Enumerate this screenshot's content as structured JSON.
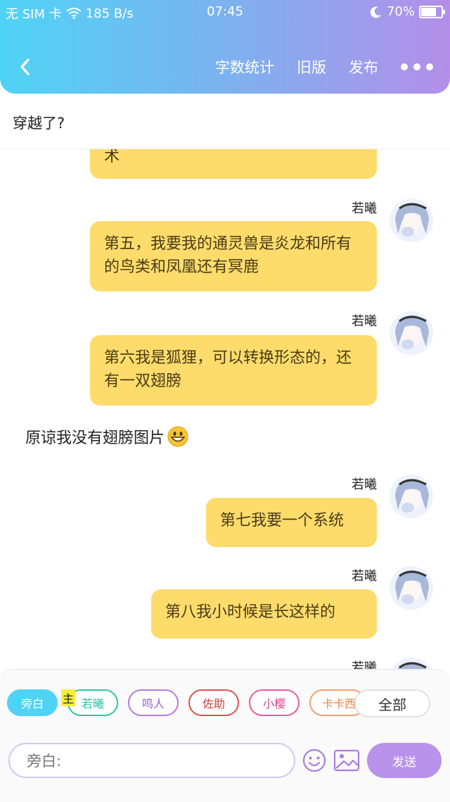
{
  "status_bar": {
    "carrier": "无 SIM 卡",
    "speed": "185 B/s",
    "time": "07:45",
    "battery": "70%",
    "battery_level": 0.7
  },
  "nav": {
    "word_count": "字数统计",
    "old_version": "旧版",
    "publish": "发布"
  },
  "story_title": "穿越了?",
  "messages": {
    "partial": {
      "text": "术"
    },
    "m5": {
      "speaker": "若曦",
      "text": "第五，我要我的通灵兽是炎龙和所有的鸟类和凤凰还有冥鹿"
    },
    "m6": {
      "speaker": "若曦",
      "text": "第六我是狐狸，可以转换形态的，还有一双翅膀"
    },
    "narration": {
      "text": "原谅我没有翅膀图片"
    },
    "m7": {
      "speaker": "若曦",
      "text": "第七我要一个系统"
    },
    "m8": {
      "speaker": "若曦",
      "text": "第八我小时候是长这样的"
    },
    "m9": {
      "speaker": "若曦"
    }
  },
  "characters": [
    {
      "label": "旁白",
      "color": "#4fd3f5",
      "active": true
    },
    {
      "label": "若曦",
      "color": "#2ec4a8"
    },
    {
      "label": "鸣人",
      "color": "#b27cdc"
    },
    {
      "label": "佐助",
      "color": "#e0504e"
    },
    {
      "label": "小樱",
      "color": "#e65ca0"
    },
    {
      "label": "卡卡西",
      "color": "#f0a070"
    }
  ],
  "main_tag": "主",
  "all_button": "全部",
  "input": {
    "placeholder": "旁白:"
  },
  "send_button": "发送",
  "colors": {
    "accent_start": "#4fd3f5",
    "accent_end": "#b48ee8",
    "bubble": "#fddc6c",
    "send": "#b992ec"
  },
  "icons": [
    "back-icon",
    "more-icon",
    "emoji-icon",
    "image-icon",
    "wifi-icon",
    "moon-icon",
    "battery-icon"
  ]
}
